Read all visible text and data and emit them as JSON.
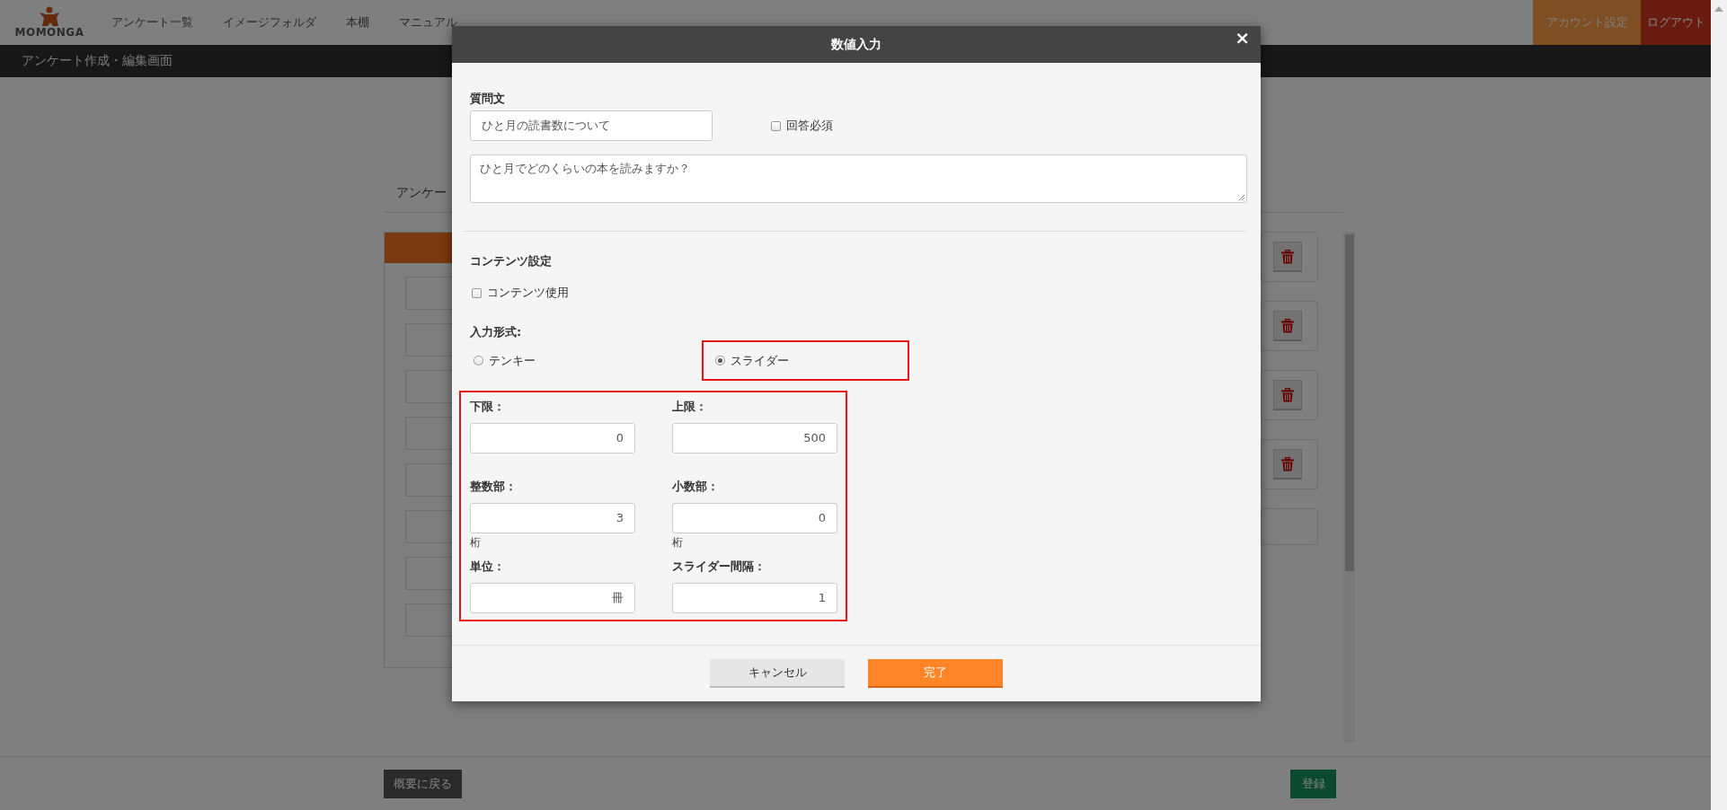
{
  "header": {
    "logo": "MOMONGA",
    "nav": [
      "アンケート一覧",
      "イメージフォルダ",
      "本棚",
      "マニュアル"
    ],
    "account_button": "アカウント設定",
    "logout_button": "ログアウト"
  },
  "subheader": {
    "title": "アンケート作成・編集画面"
  },
  "background": {
    "tab_title": "アンケー",
    "back_button": "概要に戻る",
    "register_button": "登録"
  },
  "modal": {
    "title": "数値入力",
    "close": "×",
    "question": {
      "label": "質問文",
      "title_value": "ひと月の読書数について",
      "required": {
        "label": "回答必須",
        "checked": false
      },
      "text_value": "ひと月でどのくらいの本を読みますか？"
    },
    "content": {
      "heading": "コンテンツ設定",
      "use": {
        "label": "コンテンツ使用",
        "checked": false
      }
    },
    "input_type": {
      "label": "入力形式:",
      "options": [
        {
          "label": "テンキー",
          "selected": false
        },
        {
          "label": "スライダー",
          "selected": true
        }
      ]
    },
    "fields": [
      {
        "label": "下限：",
        "value": "0"
      },
      {
        "label": "上限：",
        "value": "500"
      },
      {
        "label": "整数部：",
        "value": "3",
        "unit": "桁"
      },
      {
        "label": "小数部：",
        "value": "0",
        "unit": "桁"
      },
      {
        "label": "単位：",
        "value": "冊"
      },
      {
        "label": "スライダー間隔：",
        "value": "1"
      }
    ],
    "buttons": [
      {
        "label": "キャンセル",
        "kind": "secondary"
      },
      {
        "label": "完了",
        "kind": "primary"
      }
    ]
  }
}
